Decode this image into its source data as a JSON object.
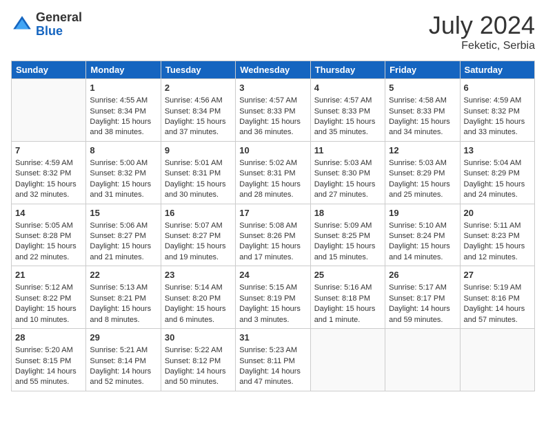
{
  "header": {
    "logo": {
      "general": "General",
      "blue": "Blue"
    },
    "title": "July 2024",
    "location": "Feketic, Serbia"
  },
  "days_of_week": [
    "Sunday",
    "Monday",
    "Tuesday",
    "Wednesday",
    "Thursday",
    "Friday",
    "Saturday"
  ],
  "weeks": [
    [
      {
        "day": "",
        "content": ""
      },
      {
        "day": "1",
        "content": "Sunrise: 4:55 AM\nSunset: 8:34 PM\nDaylight: 15 hours\nand 38 minutes."
      },
      {
        "day": "2",
        "content": "Sunrise: 4:56 AM\nSunset: 8:34 PM\nDaylight: 15 hours\nand 37 minutes."
      },
      {
        "day": "3",
        "content": "Sunrise: 4:57 AM\nSunset: 8:33 PM\nDaylight: 15 hours\nand 36 minutes."
      },
      {
        "day": "4",
        "content": "Sunrise: 4:57 AM\nSunset: 8:33 PM\nDaylight: 15 hours\nand 35 minutes."
      },
      {
        "day": "5",
        "content": "Sunrise: 4:58 AM\nSunset: 8:33 PM\nDaylight: 15 hours\nand 34 minutes."
      },
      {
        "day": "6",
        "content": "Sunrise: 4:59 AM\nSunset: 8:32 PM\nDaylight: 15 hours\nand 33 minutes."
      }
    ],
    [
      {
        "day": "7",
        "content": "Sunrise: 4:59 AM\nSunset: 8:32 PM\nDaylight: 15 hours\nand 32 minutes."
      },
      {
        "day": "8",
        "content": "Sunrise: 5:00 AM\nSunset: 8:32 PM\nDaylight: 15 hours\nand 31 minutes."
      },
      {
        "day": "9",
        "content": "Sunrise: 5:01 AM\nSunset: 8:31 PM\nDaylight: 15 hours\nand 30 minutes."
      },
      {
        "day": "10",
        "content": "Sunrise: 5:02 AM\nSunset: 8:31 PM\nDaylight: 15 hours\nand 28 minutes."
      },
      {
        "day": "11",
        "content": "Sunrise: 5:03 AM\nSunset: 8:30 PM\nDaylight: 15 hours\nand 27 minutes."
      },
      {
        "day": "12",
        "content": "Sunrise: 5:03 AM\nSunset: 8:29 PM\nDaylight: 15 hours\nand 25 minutes."
      },
      {
        "day": "13",
        "content": "Sunrise: 5:04 AM\nSunset: 8:29 PM\nDaylight: 15 hours\nand 24 minutes."
      }
    ],
    [
      {
        "day": "14",
        "content": "Sunrise: 5:05 AM\nSunset: 8:28 PM\nDaylight: 15 hours\nand 22 minutes."
      },
      {
        "day": "15",
        "content": "Sunrise: 5:06 AM\nSunset: 8:27 PM\nDaylight: 15 hours\nand 21 minutes."
      },
      {
        "day": "16",
        "content": "Sunrise: 5:07 AM\nSunset: 8:27 PM\nDaylight: 15 hours\nand 19 minutes."
      },
      {
        "day": "17",
        "content": "Sunrise: 5:08 AM\nSunset: 8:26 PM\nDaylight: 15 hours\nand 17 minutes."
      },
      {
        "day": "18",
        "content": "Sunrise: 5:09 AM\nSunset: 8:25 PM\nDaylight: 15 hours\nand 15 minutes."
      },
      {
        "day": "19",
        "content": "Sunrise: 5:10 AM\nSunset: 8:24 PM\nDaylight: 15 hours\nand 14 minutes."
      },
      {
        "day": "20",
        "content": "Sunrise: 5:11 AM\nSunset: 8:23 PM\nDaylight: 15 hours\nand 12 minutes."
      }
    ],
    [
      {
        "day": "21",
        "content": "Sunrise: 5:12 AM\nSunset: 8:22 PM\nDaylight: 15 hours\nand 10 minutes."
      },
      {
        "day": "22",
        "content": "Sunrise: 5:13 AM\nSunset: 8:21 PM\nDaylight: 15 hours\nand 8 minutes."
      },
      {
        "day": "23",
        "content": "Sunrise: 5:14 AM\nSunset: 8:20 PM\nDaylight: 15 hours\nand 6 minutes."
      },
      {
        "day": "24",
        "content": "Sunrise: 5:15 AM\nSunset: 8:19 PM\nDaylight: 15 hours\nand 3 minutes."
      },
      {
        "day": "25",
        "content": "Sunrise: 5:16 AM\nSunset: 8:18 PM\nDaylight: 15 hours\nand 1 minute."
      },
      {
        "day": "26",
        "content": "Sunrise: 5:17 AM\nSunset: 8:17 PM\nDaylight: 14 hours\nand 59 minutes."
      },
      {
        "day": "27",
        "content": "Sunrise: 5:19 AM\nSunset: 8:16 PM\nDaylight: 14 hours\nand 57 minutes."
      }
    ],
    [
      {
        "day": "28",
        "content": "Sunrise: 5:20 AM\nSunset: 8:15 PM\nDaylight: 14 hours\nand 55 minutes."
      },
      {
        "day": "29",
        "content": "Sunrise: 5:21 AM\nSunset: 8:14 PM\nDaylight: 14 hours\nand 52 minutes."
      },
      {
        "day": "30",
        "content": "Sunrise: 5:22 AM\nSunset: 8:12 PM\nDaylight: 14 hours\nand 50 minutes."
      },
      {
        "day": "31",
        "content": "Sunrise: 5:23 AM\nSunset: 8:11 PM\nDaylight: 14 hours\nand 47 minutes."
      },
      {
        "day": "",
        "content": ""
      },
      {
        "day": "",
        "content": ""
      },
      {
        "day": "",
        "content": ""
      }
    ]
  ]
}
